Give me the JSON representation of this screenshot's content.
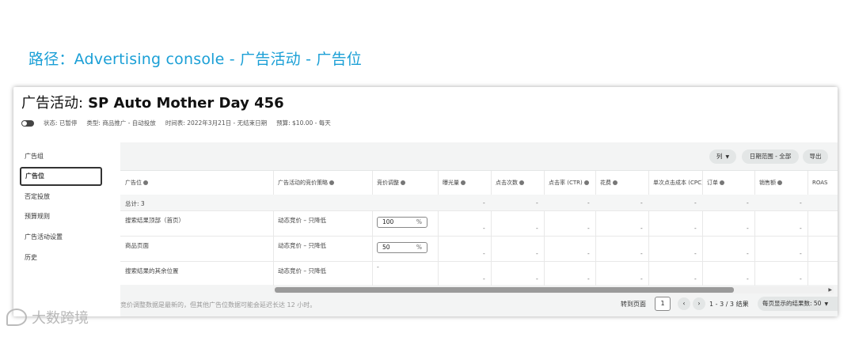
{
  "path_title": "路径：Advertising console - 广告活动 - 广告位",
  "campaign": {
    "title_prefix": "广告活动:",
    "name": "SP Auto Mother Day 456"
  },
  "meta": {
    "status": "状态: 已暂停",
    "type": "类型: 商品推广 - 自动投放",
    "schedule": "时间表: 2022年3月21日 - 无结束日期",
    "budget": "预算: $10.00 - 每天"
  },
  "sidebar": {
    "items": [
      {
        "label": "广告组"
      },
      {
        "label": "广告位"
      },
      {
        "label": "否定投放"
      },
      {
        "label": "预算规则"
      },
      {
        "label": "广告活动设置"
      },
      {
        "label": "历史"
      }
    ]
  },
  "toolbar": {
    "columns_label": "列",
    "date_range_label": "日期范围 - 全部",
    "export_label": "导出"
  },
  "table": {
    "headers": [
      "广告位",
      "广告活动的竞价策略",
      "竞价调整",
      "曝光量",
      "点击次数",
      "点击率 (CTR)",
      "花费",
      "单次点击成本 (CPC)",
      "订单",
      "销售额",
      "ROAS"
    ],
    "total_label": "总计: 3",
    "rows": [
      {
        "placement": "搜索结果顶部（首页）",
        "strategy": "动态竞价 – 只降低",
        "bid": "100",
        "bid_unit": "%"
      },
      {
        "placement": "商品页面",
        "strategy": "动态竞价 – 只降低",
        "bid": "50",
        "bid_unit": "%"
      },
      {
        "placement": "搜索结果的其余位置",
        "strategy": "动态竞价 – 只降低",
        "bid": "-",
        "bid_unit": ""
      }
    ],
    "dash": "-"
  },
  "footer": {
    "note": "竞价调整数据是最新的，但其他广告位数据可能会延迟长达 12 小时。",
    "goto_label": "转到页面",
    "page_value": "1",
    "range": "1 - 3 / 3 结果",
    "per_page": "每页显示的结果数: 50"
  },
  "watermark": "大数跨境"
}
